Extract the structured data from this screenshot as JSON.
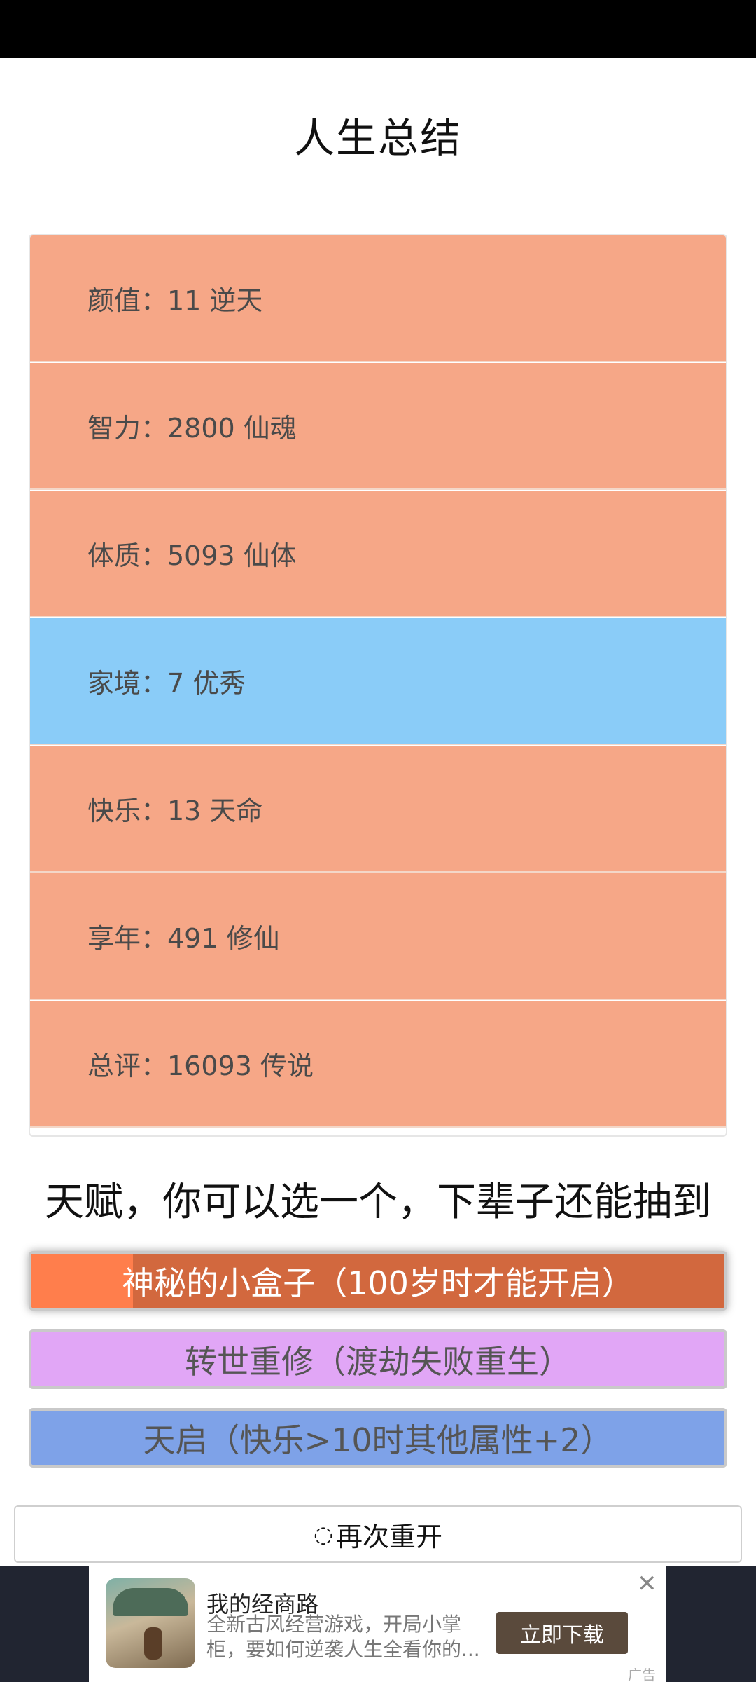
{
  "page": {
    "title": "人生总结"
  },
  "summary": [
    {
      "label": "颜值：11 逆天",
      "grade": "orange"
    },
    {
      "label": "智力：2800 仙魂",
      "grade": "orange"
    },
    {
      "label": "体质：5093 仙体",
      "grade": "orange"
    },
    {
      "label": "家境：7 优秀",
      "grade": "blue"
    },
    {
      "label": "快乐：13 天命",
      "grade": "orange"
    },
    {
      "label": "享年：491 修仙",
      "grade": "orange"
    },
    {
      "label": "总评：16093 传说",
      "grade": "orange"
    }
  ],
  "talents": {
    "heading": "天赋，你可以选一个，下辈子还能抽到",
    "items": [
      {
        "label": "神秘的小盒子（100岁时才能开启）"
      },
      {
        "label": "转世重修（渡劫失败重生）"
      },
      {
        "label": "天启（快乐>10时其他属性+2）"
      }
    ]
  },
  "restart": {
    "icon": "refresh-icon",
    "label": "再次重开"
  },
  "ad": {
    "title": "我的经商路",
    "description": "全新古风经营游戏，开局小掌柜，要如何逆袭人生全看你的...",
    "cta": "立即下载",
    "tag": "广告"
  },
  "colors": {
    "grade_orange": "#f6a787",
    "grade_blue": "#8accf8",
    "talent_1": "#d2683e",
    "talent_2": "#e1a6f6",
    "talent_3": "#7ea2e8"
  }
}
